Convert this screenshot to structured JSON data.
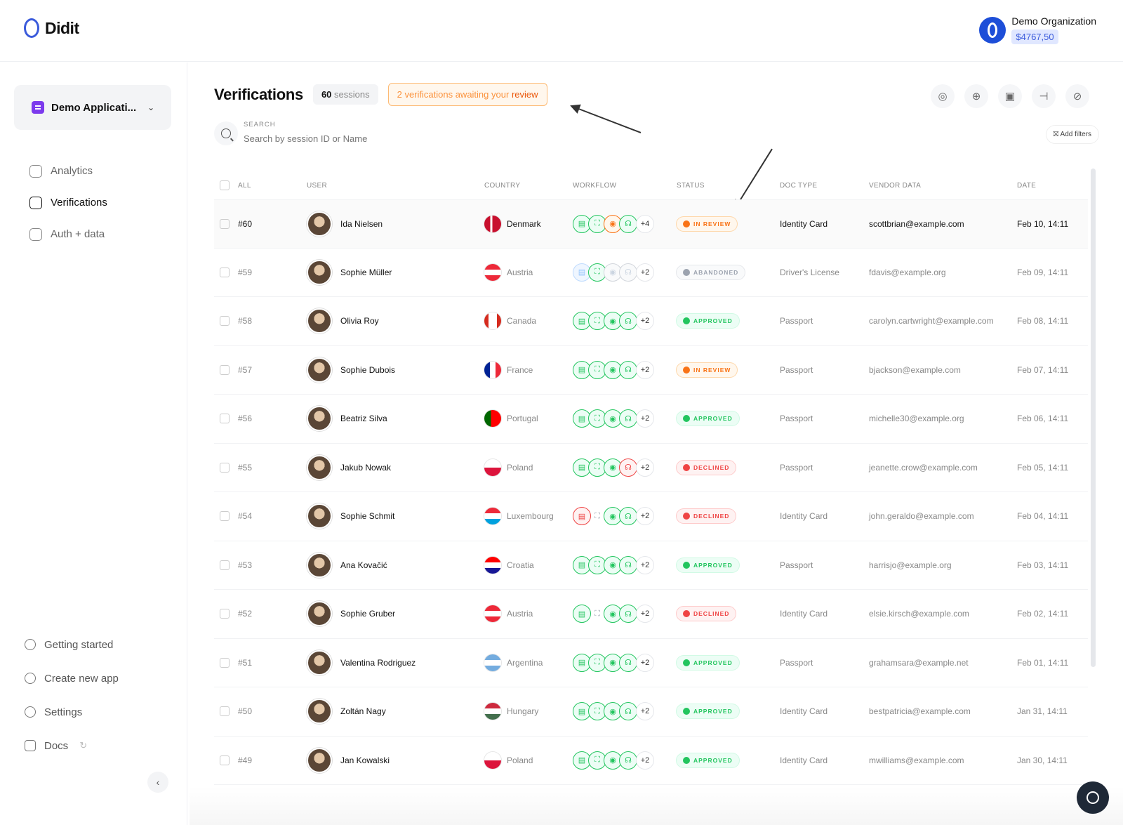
{
  "brand": {
    "name": "Didit"
  },
  "org": {
    "name": "Demo Organization",
    "balance": "$4767,50"
  },
  "sidebar": {
    "app_name": "Demo Applicati...",
    "nav": [
      {
        "label": "Analytics",
        "icon": "analytics-icon"
      },
      {
        "label": "Verifications",
        "icon": "verifications-icon",
        "active": true
      },
      {
        "label": "Auth + data",
        "icon": "auth-icon"
      }
    ],
    "bottom": [
      {
        "label": "Getting started",
        "icon": "play-icon"
      },
      {
        "label": "Create new app",
        "icon": "plus-circle-icon"
      },
      {
        "label": "Settings",
        "icon": "gear-icon"
      },
      {
        "label": "Docs",
        "icon": "docs-icon"
      }
    ]
  },
  "header": {
    "title": "Verifications",
    "sessions_count": "60",
    "sessions_label": "sessions",
    "review_text": "2 verifications awaiting your",
    "review_link": "review"
  },
  "toolbar": {
    "icons": [
      "settings-icon",
      "add-icon",
      "export-icon",
      "flow-icon",
      "block-icon"
    ],
    "add_filters": "Add filters"
  },
  "search": {
    "label": "SEARCH",
    "placeholder": "Search by session ID or Name"
  },
  "table": {
    "columns": {
      "all": "ALL",
      "user": "USER",
      "country": "COUNTRY",
      "workflow": "WORKFLOW",
      "status": "STATUS",
      "doc_type": "DOC TYPE",
      "vendor_data": "VENDOR DATA",
      "date": "DATE"
    },
    "rows": [
      {
        "id": "#60",
        "user": "Ida Nielsen",
        "country": "Denmark",
        "wf": [
          "green",
          "green",
          "orange",
          "green"
        ],
        "more": "+4",
        "status": "IN REVIEW",
        "status_type": "review",
        "doc": "Identity Card",
        "vendor": "scottbrian@example.com",
        "date": "Feb 10, 14:11"
      },
      {
        "id": "#59",
        "user": "Sophie Müller",
        "country": "Austria",
        "wf": [
          "blue",
          "green",
          "grey",
          "grey"
        ],
        "more": "+2",
        "status": "ABANDONED",
        "status_type": "abandoned",
        "doc": "Driver's License",
        "vendor": "fdavis@example.org",
        "date": "Feb 09, 14:11"
      },
      {
        "id": "#58",
        "user": "Olivia Roy",
        "country": "Canada",
        "wf": [
          "green",
          "green",
          "green",
          "green"
        ],
        "more": "+2",
        "status": "APPROVED",
        "status_type": "approved",
        "doc": "Passport",
        "vendor": "carolyn.cartwright@example.com",
        "date": "Feb 08, 14:11"
      },
      {
        "id": "#57",
        "user": "Sophie Dubois",
        "country": "France",
        "wf": [
          "green",
          "green",
          "green",
          "green"
        ],
        "more": "+2",
        "status": "IN REVIEW",
        "status_type": "review",
        "doc": "Passport",
        "vendor": "bjackson@example.com",
        "date": "Feb 07, 14:11"
      },
      {
        "id": "#56",
        "user": "Beatriz Silva",
        "country": "Portugal",
        "wf": [
          "green",
          "green",
          "green",
          "green"
        ],
        "more": "+2",
        "status": "APPROVED",
        "status_type": "approved",
        "doc": "Passport",
        "vendor": "michelle30@example.org",
        "date": "Feb 06, 14:11"
      },
      {
        "id": "#55",
        "user": "Jakub Nowak",
        "country": "Poland",
        "wf": [
          "green",
          "green",
          "green",
          "red"
        ],
        "more": "+2",
        "status": "DECLINED",
        "status_type": "declined",
        "doc": "Passport",
        "vendor": "jeanette.crow@example.com",
        "date": "Feb 05, 14:11"
      },
      {
        "id": "#54",
        "user": "Sophie Schmit",
        "country": "Luxembourg",
        "wf": [
          "red",
          "none",
          "green",
          "green"
        ],
        "more": "+2",
        "status": "DECLINED",
        "status_type": "declined",
        "doc": "Identity Card",
        "vendor": "john.geraldo@example.com",
        "date": "Feb 04, 14:11"
      },
      {
        "id": "#53",
        "user": "Ana Kovačić",
        "country": "Croatia",
        "wf": [
          "green",
          "green",
          "green",
          "green"
        ],
        "more": "+2",
        "status": "APPROVED",
        "status_type": "approved",
        "doc": "Passport",
        "vendor": "harrisjo@example.org",
        "date": "Feb 03, 14:11"
      },
      {
        "id": "#52",
        "user": "Sophie Gruber",
        "country": "Austria",
        "wf": [
          "green",
          "none",
          "green",
          "green"
        ],
        "more": "+2",
        "status": "DECLINED",
        "status_type": "declined",
        "doc": "Identity Card",
        "vendor": "elsie.kirsch@example.com",
        "date": "Feb 02, 14:11"
      },
      {
        "id": "#51",
        "user": "Valentina Rodriguez",
        "country": "Argentina",
        "wf": [
          "green",
          "green",
          "green",
          "green"
        ],
        "more": "+2",
        "status": "APPROVED",
        "status_type": "approved",
        "doc": "Passport",
        "vendor": "grahamsara@example.net",
        "date": "Feb 01, 14:11"
      },
      {
        "id": "#50",
        "user": "Zoltán Nagy",
        "country": "Hungary",
        "wf": [
          "green",
          "green",
          "green",
          "green"
        ],
        "more": "+2",
        "status": "APPROVED",
        "status_type": "approved",
        "doc": "Identity Card",
        "vendor": "bestpatricia@example.com",
        "date": "Jan 31, 14:11"
      },
      {
        "id": "#49",
        "user": "Jan Kowalski",
        "country": "Poland",
        "wf": [
          "green",
          "green",
          "green",
          "green"
        ],
        "more": "+2",
        "status": "APPROVED",
        "status_type": "approved",
        "doc": "Identity Card",
        "vendor": "mwilliams@example.com",
        "date": "Jan 30, 14:11"
      }
    ]
  }
}
